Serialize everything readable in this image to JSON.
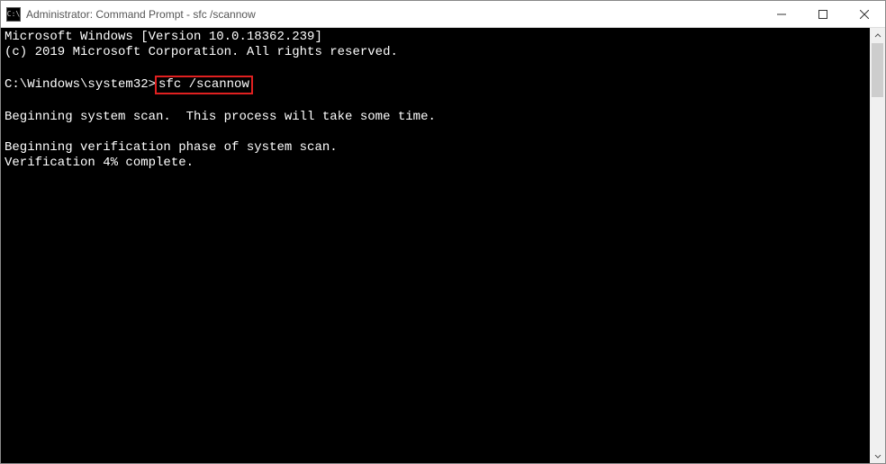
{
  "titlebar": {
    "icon_label": "C:\\",
    "title": "Administrator: Command Prompt - sfc  /scannow"
  },
  "console": {
    "banner_line1": "Microsoft Windows [Version 10.0.18362.239]",
    "banner_line2": "(c) 2019 Microsoft Corporation. All rights reserved.",
    "prompt_prefix": "C:\\Windows\\system32>",
    "command": "sfc /scannow",
    "msg_beginning": "Beginning system scan.  This process will take some time.",
    "msg_verify_phase": "Beginning verification phase of system scan.",
    "msg_verify_progress": "Verification 4% complete."
  }
}
